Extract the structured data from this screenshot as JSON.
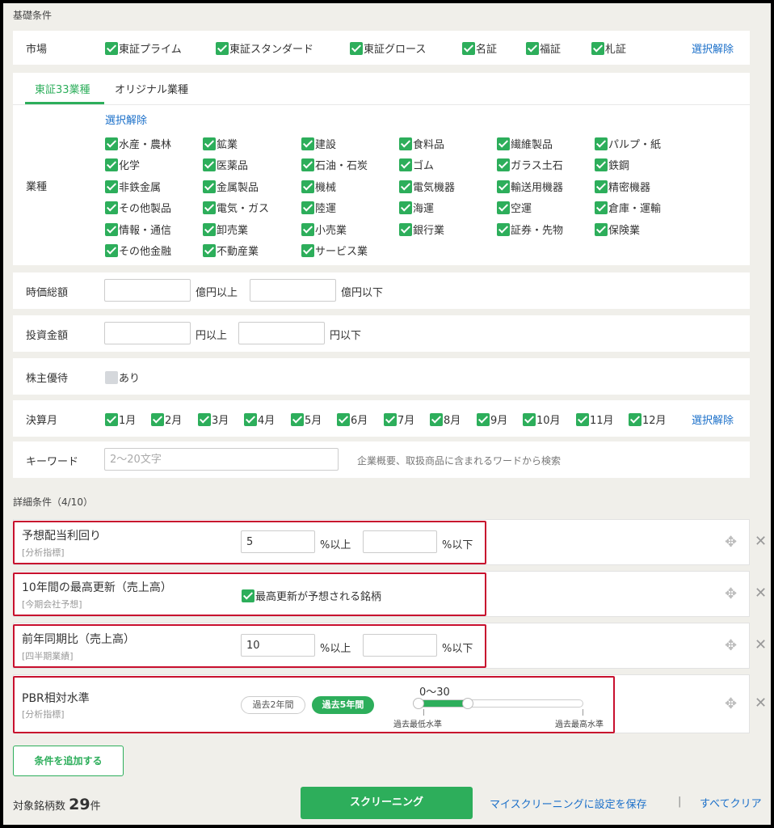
{
  "basic": {
    "title": "基礎条件",
    "market": {
      "label": "市場",
      "options": [
        "東証プライム",
        "東証スタンダード",
        "東証グロース",
        "名証",
        "福証",
        "札証"
      ],
      "clear": "選択解除"
    },
    "industry_tabs": [
      "東証33業種",
      "オリジナル業種"
    ],
    "industry": {
      "label": "業種",
      "clear": "選択解除",
      "options": [
        "水産・農林",
        "鉱業",
        "建設",
        "食料品",
        "繊維製品",
        "パルプ・紙",
        "化学",
        "医薬品",
        "石油・石炭",
        "ゴム",
        "ガラス土石",
        "鉄鋼",
        "非鉄金属",
        "金属製品",
        "機械",
        "電気機器",
        "輸送用機器",
        "精密機器",
        "その他製品",
        "電気・ガス",
        "陸運",
        "海運",
        "空運",
        "倉庫・運輸",
        "情報・通信",
        "卸売業",
        "小売業",
        "銀行業",
        "証券・先物",
        "保険業",
        "その他金融",
        "不動産業",
        "サービス業"
      ]
    },
    "market_cap": {
      "label": "時価総額",
      "unit_min": "億円以上",
      "unit_max": "億円以下"
    },
    "investment": {
      "label": "投資金額",
      "unit_min": "円以上",
      "unit_max": "円以下"
    },
    "benefit": {
      "label": "株主優待",
      "option": "あり"
    },
    "fiscal_month": {
      "label": "決算月",
      "months": [
        "1月",
        "2月",
        "3月",
        "4月",
        "5月",
        "6月",
        "7月",
        "8月",
        "9月",
        "10月",
        "11月",
        "12月"
      ],
      "clear": "選択解除"
    },
    "keyword": {
      "label": "キーワード",
      "placeholder": "2〜20文字",
      "hint": "企業概要、取扱商品に含まれるワードから検索"
    }
  },
  "detail": {
    "title": "詳細条件（4/10）",
    "conditions": [
      {
        "title": "予想配当利回り",
        "sub": "[分析指標]",
        "min": "5",
        "unit_min": "%以上",
        "unit_max": "%以下"
      },
      {
        "title": "10年間の最高更新（売上高）",
        "sub": "[今期会社予想]",
        "checkbox": "最高更新が予想される銘柄"
      },
      {
        "title": "前年同期比（売上高）",
        "sub": "[四半期業績]",
        "min": "10",
        "unit_min": "%以上",
        "unit_max": "%以下"
      },
      {
        "title": "PBR相対水準",
        "sub": "[分析指標]",
        "periods": [
          "過去2年間",
          "過去5年間"
        ],
        "selected_period": "過去5年間",
        "range_label": "0〜30",
        "range_min": 0,
        "range_max": 30,
        "low_label": "過去最低水準",
        "high_label": "過去最高水準"
      }
    ],
    "move_icon": "move-icon",
    "close_icon": "close-icon"
  },
  "footer": {
    "add_condition": "条件を追加する",
    "count_label": "対象銘柄数",
    "count": "29",
    "count_unit": "件",
    "screen_button": "スクリーニング",
    "save_link": "マイスクリーニングに設定を保存",
    "separator": "|",
    "clear_all": "すべてクリア"
  },
  "colors": {
    "accent": "#2dae5b",
    "link": "#1a6fc9",
    "highlight": "#c8102e",
    "background": "#f0efea"
  }
}
